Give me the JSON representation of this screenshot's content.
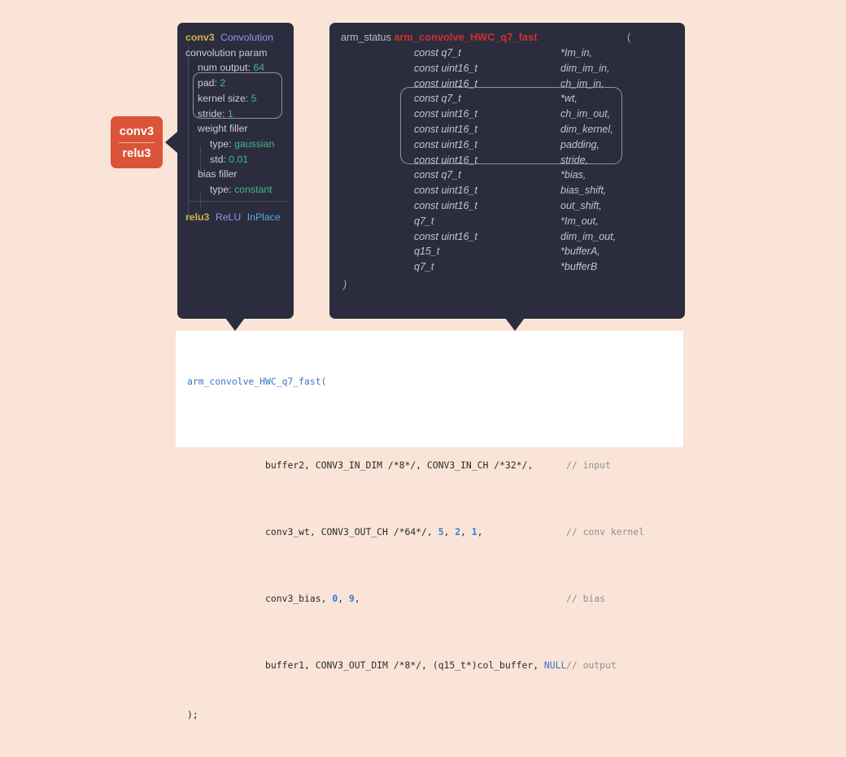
{
  "background_color": "#fae4d8",
  "node": {
    "title": "conv3",
    "subtitle": "relu3",
    "color": "#db543a"
  },
  "layer_panel": {
    "background": "#2b2d3e",
    "header": {
      "name": "conv3",
      "type": "Convolution"
    },
    "section_convolution_param": "convolution param",
    "params": [
      {
        "key": "num output:",
        "value": "64"
      },
      {
        "key": "pad:",
        "value": "2"
      },
      {
        "key": "kernel size:",
        "value": "5"
      },
      {
        "key": "stride:",
        "value": "1"
      }
    ],
    "weight_filler_label": "weight filler",
    "weight_filler": [
      {
        "key": "type:",
        "value": "gaussian"
      },
      {
        "key": "std:",
        "value": "0.01"
      }
    ],
    "bias_filler_label": "bias filler",
    "bias_filler": [
      {
        "key": "type:",
        "value": "constant"
      }
    ],
    "footer": {
      "name": "relu3",
      "type": "ReLU",
      "flag": "InPlace"
    },
    "highlight_note": "pad / kernel size / stride highlighted with rounded outline"
  },
  "signature_panel": {
    "background": "#2b2d3e",
    "return_type": "arm_status",
    "function_name": "arm_convolve_HWC_q7_fast",
    "function_name_color": "#d42e2e",
    "open_paren": "(",
    "close_paren": ")",
    "parameters": [
      {
        "type": "const q7_t",
        "name": "*Im_in,"
      },
      {
        "type": "const uint16_t",
        "name": "dim_im_in,"
      },
      {
        "type": "const uint16_t",
        "name": "ch_im_in,"
      },
      {
        "type": "const q7_t",
        "name": "*wt,"
      },
      {
        "type": "const uint16_t",
        "name": "ch_im_out,"
      },
      {
        "type": "const uint16_t",
        "name": "dim_kernel,"
      },
      {
        "type": "const uint16_t",
        "name": "padding,"
      },
      {
        "type": "const uint16_t",
        "name": "stride,"
      },
      {
        "type": "const q7_t",
        "name": "*bias,"
      },
      {
        "type": "const uint16_t",
        "name": "bias_shift,"
      },
      {
        "type": "const uint16_t",
        "name": "out_shift,"
      },
      {
        "type": "q7_t",
        "name": "*Im_out,"
      },
      {
        "type": "const uint16_t",
        "name": "dim_im_out,"
      },
      {
        "type": "q15_t",
        "name": "*bufferA,"
      },
      {
        "type": "q7_t",
        "name": "*bufferB"
      }
    ],
    "highlight_range": [
      3,
      7
    ]
  },
  "code_panel": {
    "background": "#ffffff",
    "call_name": "arm_convolve_HWC_q7_fast(",
    "lines": [
      {
        "args": "buffer2, CONV3_IN_DIM /*8*/, CONV3_IN_CH /*32*/,",
        "comment": "// input"
      },
      {
        "args": "conv3_wt, CONV3_OUT_CH /*64*/, 5, 2, 1,",
        "comment": "// conv kernel"
      },
      {
        "args": "conv3_bias, 0, 9,",
        "comment": "// bias"
      },
      {
        "args": "buffer1, CONV3_OUT_DIM /*8*/, (q15_t*)col_buffer, NULL",
        "comment": "// output"
      }
    ],
    "terminator": ");"
  }
}
